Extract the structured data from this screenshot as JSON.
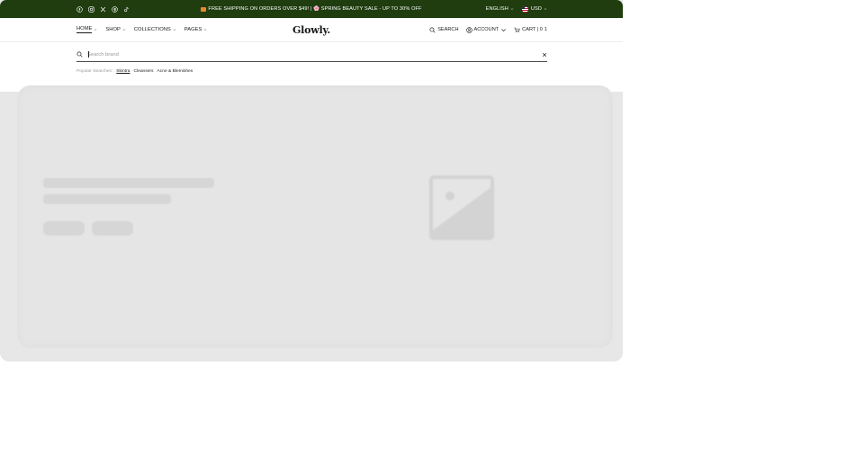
{
  "announcement": {
    "promo_text": "FREE SHIPPING ON ORDERS OVER $49! | 🌸 SPRING BEAUTY SALE - UP TO 30% OFF",
    "promo_prefix_emoji_color": "#e8892c",
    "language": "ENGLISH",
    "currency": "USD",
    "social_icons": [
      "facebook-icon",
      "instagram-icon",
      "x-icon",
      "pinterest-icon",
      "tiktok-icon"
    ]
  },
  "header": {
    "logo": "Glowly.",
    "nav": [
      {
        "label": "HOME",
        "active": true
      },
      {
        "label": "SHOP"
      },
      {
        "label": "COLLECTIONS"
      },
      {
        "label": "PAGES"
      }
    ],
    "search_label": "SEARCH",
    "account_label": "ACCOUNT",
    "cart_label": "CART | 0",
    "cart_count": "1"
  },
  "search": {
    "placeholder": "Search brand",
    "popular_label": "Popular Searches:",
    "popular_terms": [
      "Skintra",
      "Cleansers",
      "Acne & Blemishes"
    ]
  },
  "colors": {
    "topbar_bg": "#1f3d0f",
    "skeleton_bg": "#e7e7e7",
    "skeleton_block": "#d6d6d6"
  }
}
